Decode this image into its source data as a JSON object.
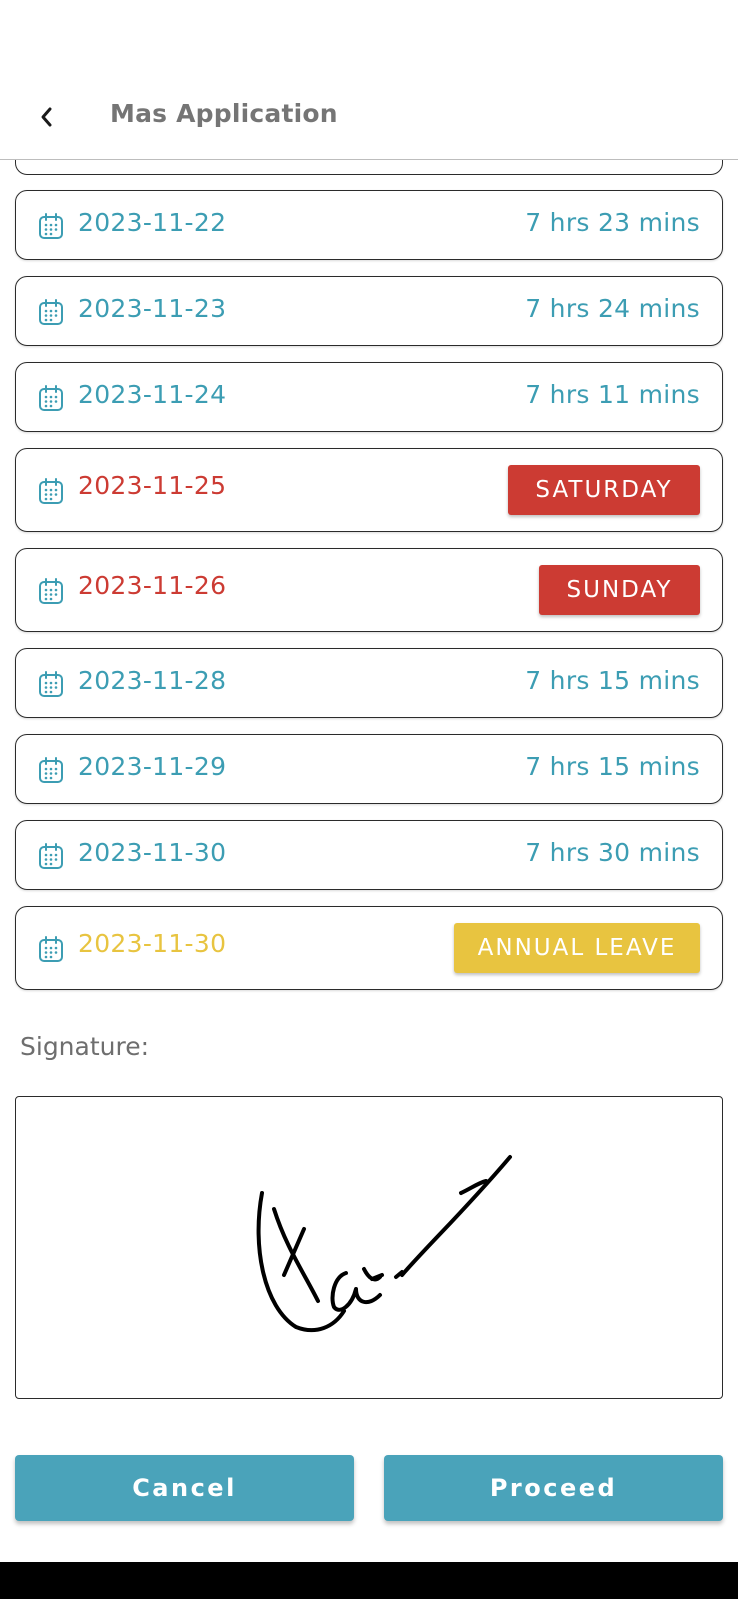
{
  "header": {
    "title": "Mas Application",
    "back_icon": "chevron-left-icon"
  },
  "colors": {
    "teal": "#3c9db3",
    "weekend_red": "#cc3b33",
    "leave_yellow": "#e8c440",
    "button": "#4aa3ba"
  },
  "attendance": [
    {
      "date": "2023-11-22",
      "duration": "7 hrs 23 mins",
      "type": "work"
    },
    {
      "date": "2023-11-23",
      "duration": "7 hrs 24 mins",
      "type": "work"
    },
    {
      "date": "2023-11-24",
      "duration": "7 hrs 11 mins",
      "type": "work"
    },
    {
      "date": "2023-11-25",
      "badge": "SATURDAY",
      "type": "weekend"
    },
    {
      "date": "2023-11-26",
      "badge": "SUNDAY",
      "type": "weekend"
    },
    {
      "date": "2023-11-28",
      "duration": "7 hrs 15 mins",
      "type": "work"
    },
    {
      "date": "2023-11-29",
      "duration": "7 hrs 15 mins",
      "type": "work"
    },
    {
      "date": "2023-11-30",
      "duration": "7 hrs 30 mins",
      "type": "work"
    },
    {
      "date": "2023-11-30",
      "badge": "ANNUAL LEAVE",
      "type": "leave"
    }
  ],
  "signature": {
    "label": "Signature:"
  },
  "actions": {
    "cancel_label": "Cancel",
    "proceed_label": "Proceed"
  }
}
